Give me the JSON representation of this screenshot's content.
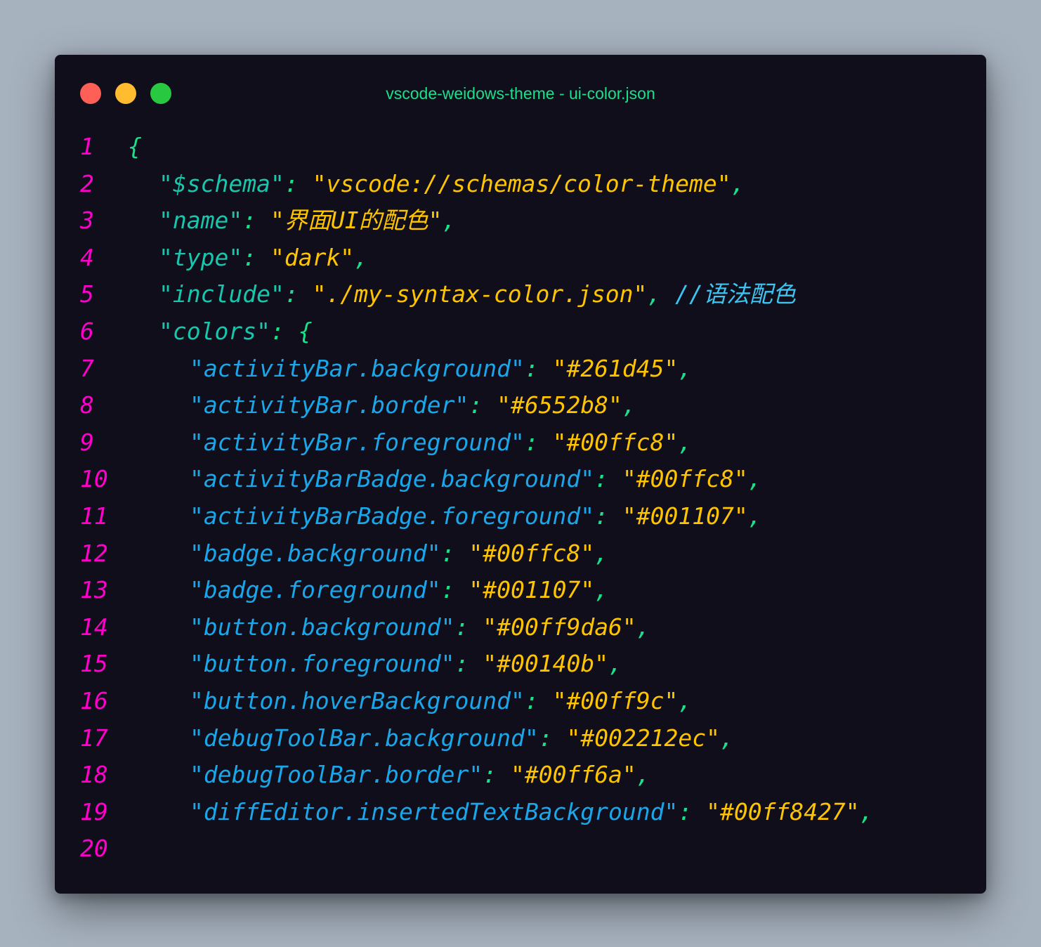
{
  "window": {
    "title": "vscode-weidows-theme - ui-color.json",
    "buttons": {
      "close_color": "#fe5f57",
      "minimize_color": "#febc2e",
      "maximize_color": "#28c840"
    }
  },
  "theme_colors": {
    "background": "#100e1b",
    "line_number": "#ff00cc",
    "brace": "#19e08a",
    "top_key": "#18c6ac",
    "color_key": "#1aa6e8",
    "string_value": "#ffc400",
    "punctuation": "#19e08a",
    "comment": "#3ec3f2",
    "title": "#19e08a"
  },
  "editor": {
    "lines": [
      {
        "num": "1",
        "indent": 0,
        "key": "",
        "value": "",
        "open": "{",
        "comment": ""
      },
      {
        "num": "2",
        "indent": 1,
        "key": "\"$schema\"",
        "value": "\"vscode://schemas/color-theme\"",
        "open": "",
        "comment": ""
      },
      {
        "num": "3",
        "indent": 1,
        "key": "\"name\"",
        "value": "\"界面UI的配色\"",
        "open": "",
        "comment": ""
      },
      {
        "num": "4",
        "indent": 1,
        "key": "\"type\"",
        "value": "\"dark\"",
        "open": "",
        "comment": ""
      },
      {
        "num": "5",
        "indent": 1,
        "key": "\"include\"",
        "value": "\"./my-syntax-color.json\"",
        "open": "",
        "comment": "//语法配色"
      },
      {
        "num": "6",
        "indent": 1,
        "key": "\"colors\"",
        "value": "",
        "open": "{",
        "comment": ""
      },
      {
        "num": "7",
        "indent": 2,
        "key": "\"activityBar.background\"",
        "value": "\"#261d45\"",
        "open": "",
        "comment": ""
      },
      {
        "num": "8",
        "indent": 2,
        "key": "\"activityBar.border\"",
        "value": "\"#6552b8\"",
        "open": "",
        "comment": ""
      },
      {
        "num": "9",
        "indent": 2,
        "key": "\"activityBar.foreground\"",
        "value": "\"#00ffc8\"",
        "open": "",
        "comment": ""
      },
      {
        "num": "10",
        "indent": 2,
        "key": "\"activityBarBadge.background\"",
        "value": "\"#00ffc8\"",
        "open": "",
        "comment": ""
      },
      {
        "num": "11",
        "indent": 2,
        "key": "\"activityBarBadge.foreground\"",
        "value": "\"#001107\"",
        "open": "",
        "comment": ""
      },
      {
        "num": "12",
        "indent": 2,
        "key": "\"badge.background\"",
        "value": "\"#00ffc8\"",
        "open": "",
        "comment": ""
      },
      {
        "num": "13",
        "indent": 2,
        "key": "\"badge.foreground\"",
        "value": "\"#001107\"",
        "open": "",
        "comment": ""
      },
      {
        "num": "14",
        "indent": 2,
        "key": "\"button.background\"",
        "value": "\"#00ff9da6\"",
        "open": "",
        "comment": ""
      },
      {
        "num": "15",
        "indent": 2,
        "key": "\"button.foreground\"",
        "value": "\"#00140b\"",
        "open": "",
        "comment": ""
      },
      {
        "num": "16",
        "indent": 2,
        "key": "\"button.hoverBackground\"",
        "value": "\"#00ff9c\"",
        "open": "",
        "comment": ""
      },
      {
        "num": "17",
        "indent": 2,
        "key": "\"debugToolBar.background\"",
        "value": "\"#002212ec\"",
        "open": "",
        "comment": ""
      },
      {
        "num": "18",
        "indent": 2,
        "key": "\"debugToolBar.border\"",
        "value": "\"#00ff6a\"",
        "open": "",
        "comment": ""
      },
      {
        "num": "19",
        "indent": 2,
        "key": "\"diffEditor.insertedTextBackground\"",
        "value": "\"#00ff8427\"",
        "open": "",
        "comment": ""
      },
      {
        "num": "20",
        "indent": 0,
        "key": "",
        "value": "",
        "open": "",
        "comment": ""
      }
    ]
  }
}
